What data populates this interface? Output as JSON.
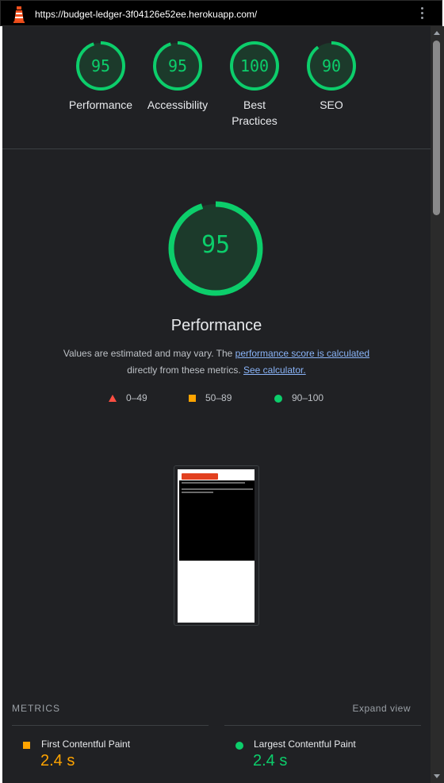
{
  "browser": {
    "url": "https://budget-ledger-3f04126e52ee.herokuapp.com/",
    "logo_icon": "lighthouse-icon",
    "menu_icon": "kebab-menu-icon"
  },
  "scores": [
    {
      "value": "95",
      "label": "Performance"
    },
    {
      "value": "95",
      "label": "Accessibility"
    },
    {
      "value": "100",
      "label": "Best Practices"
    },
    {
      "value": "90",
      "label": "SEO"
    }
  ],
  "performance": {
    "score": "95",
    "title": "Performance",
    "desc_prefix": "Values are estimated and may vary. The ",
    "link1": "performance score is calculated",
    "desc_middle": "directly from these metrics. ",
    "link2": "See calculator."
  },
  "legend": [
    {
      "shape": "triangle",
      "range": "0–49",
      "color": "#ff4e42"
    },
    {
      "shape": "square",
      "range": "50–89",
      "color": "#ffa400"
    },
    {
      "shape": "circle",
      "range": "90–100",
      "color": "#0cce6b"
    }
  ],
  "metrics": {
    "heading": "METRICS",
    "expand_label": "Expand view",
    "items": [
      {
        "name": "First Contentful Paint",
        "value": "2.4 s",
        "rating": "average",
        "color": "#ffa400"
      },
      {
        "name": "Largest Contentful Paint",
        "value": "2.4 s",
        "rating": "pass",
        "color": "#0cce6b"
      }
    ]
  },
  "colors": {
    "pass": "#0cce6b",
    "average": "#ffa400",
    "fail": "#ff4e42",
    "background": "#202124",
    "link": "#8ab4f8"
  }
}
